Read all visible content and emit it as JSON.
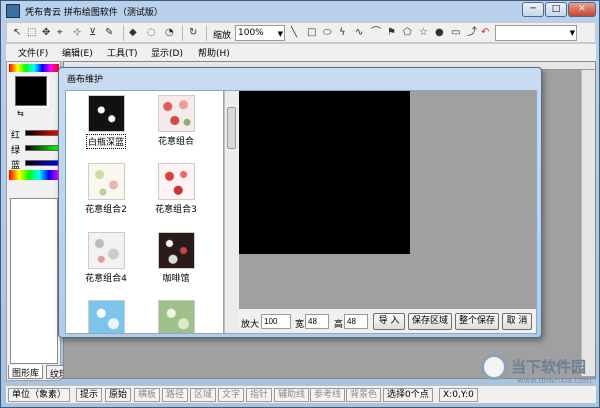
{
  "window": {
    "title": "凭布青云 拼布绘图软件（测试版）",
    "controls": {
      "minimize": "─",
      "restore": "□",
      "close": "✕"
    }
  },
  "toolbar": {
    "zoom_label": "缩放",
    "zoom_value": "100%",
    "icons": [
      "pointer-icon",
      "rect-select-icon",
      "move-icon",
      "node-icon",
      "node-add-icon",
      "node-delete-icon",
      "ellipse-select-icon",
      "lasso-icon",
      "rotate-icon",
      "line-icon",
      "rectangle-icon",
      "ellipse-icon",
      "zigzag-icon",
      "curve-icon",
      "arc-icon",
      "flag-icon",
      "polygon-icon",
      "star-icon",
      "circle-icon",
      "page-icon",
      "undo-icon"
    ]
  },
  "menu": [
    "文件(F)",
    "编辑(E)",
    "工具(T)",
    "显示(D)",
    "帮助(H)"
  ],
  "left_panel": {
    "labels": {
      "red": "红",
      "green": "绿",
      "blue": "蓝"
    },
    "tabs": [
      "图形库",
      "纹理库"
    ]
  },
  "dialog": {
    "title": "画布维护",
    "textures": [
      {
        "label": "白瓶深蓝",
        "selected": true
      },
      {
        "label": "花意组合",
        "selected": false
      },
      {
        "label": "花意组合2",
        "selected": false
      },
      {
        "label": "花意组合3",
        "selected": false
      },
      {
        "label": "花意组合4",
        "selected": false
      },
      {
        "label": "咖啡馆",
        "selected": false
      },
      {
        "label": "",
        "selected": false
      },
      {
        "label": "",
        "selected": false
      }
    ],
    "controls": {
      "scale_label": "放大",
      "scale_value": "100",
      "width_label": "宽",
      "width_value": "48",
      "height_label": "高",
      "height_value": "48",
      "import_btn": "导 入",
      "save_area_btn": "保存区域",
      "save_all_btn": "整个保存",
      "cancel_btn": "取 消"
    }
  },
  "statusbar": {
    "unit": "单位（象素）",
    "hint": "提示",
    "items": [
      "原始",
      "横板",
      "路径",
      "区域",
      "文字",
      "指针",
      "辅助线",
      "参考线",
      "背景色"
    ],
    "selected": "选择0个点",
    "coords": "X:0,Y:0"
  },
  "watermark": {
    "text": "当下软件园",
    "sub": "www.downxia.com"
  },
  "colors": {
    "titlebar": "#b9d1ea",
    "canvas": "#000000",
    "workspace": "#a0a0a0"
  }
}
